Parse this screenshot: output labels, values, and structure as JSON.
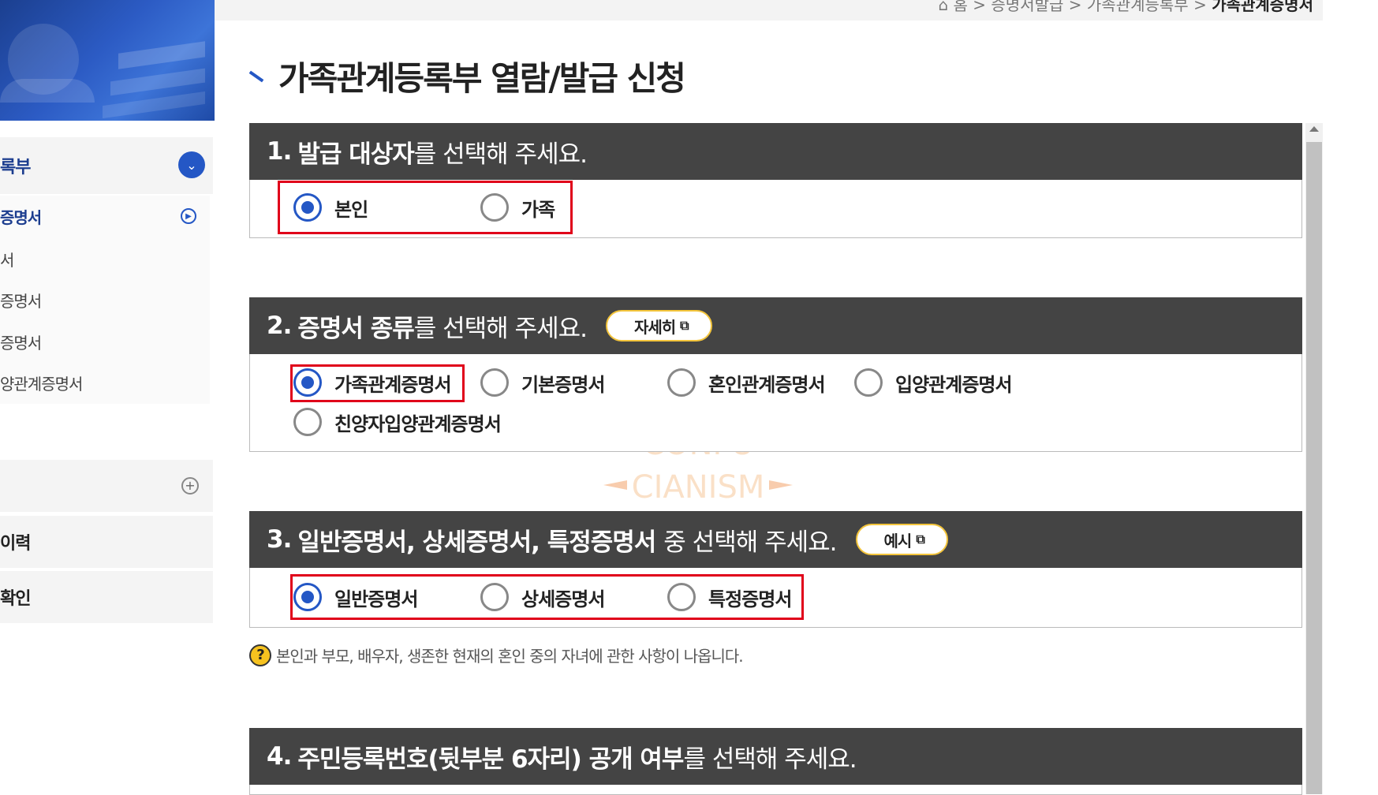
{
  "sidebar": {
    "menu_head_label": "록부",
    "sub_items": [
      "증명서",
      "서",
      "증명서",
      "증명서",
      "양관계증명서"
    ],
    "row1_label": "",
    "row2_label": "이력",
    "row3_label": "확인"
  },
  "breadcrumb": {
    "home": "홈",
    "sep": ">",
    "level1": "증명서발급",
    "level2": "가족관계등록부",
    "current": "가족관계증명서"
  },
  "page": {
    "title": "가족관계등록부 열람/발급 신청"
  },
  "sections": [
    {
      "num": "1.",
      "bold": "발급 대상자",
      "rest": "를 선택해 주세요.",
      "options": [
        {
          "label": "본인",
          "checked": true
        },
        {
          "label": "가족",
          "checked": false
        }
      ]
    },
    {
      "num": "2.",
      "bold": "증명서 종류",
      "rest": "를 선택해 주세요.",
      "button": "자세히",
      "options": [
        {
          "label": "가족관계증명서",
          "checked": true
        },
        {
          "label": "기본증명서",
          "checked": false
        },
        {
          "label": "혼인관계증명서",
          "checked": false
        },
        {
          "label": "입양관계증명서",
          "checked": false
        },
        {
          "label": "친양자입양관계증명서",
          "checked": false
        }
      ]
    },
    {
      "num": "3.",
      "bold": "일반증명서, 상세증명서, 특정증명서",
      "rest": "중 선택해 주세요.",
      "button": "예시",
      "options": [
        {
          "label": "일반증명서",
          "checked": true
        },
        {
          "label": "상세증명서",
          "checked": false
        },
        {
          "label": "특정증명서",
          "checked": false
        }
      ]
    },
    {
      "num": "4.",
      "bold": "주민등록번호(뒷부분 6자리) 공개 여부",
      "rest": "를 선택해 주세요."
    }
  ],
  "note": {
    "icon": "question-icon",
    "text": "본인과 부모, 배우자, 생존한 현재의 혼인 중의 자녀에 관한 사항이 나옵니다."
  },
  "watermark": [
    "CONFU",
    "CIANISM"
  ],
  "colors": {
    "accent": "#2457c5",
    "section_bar": "#444444",
    "highlight": "#e0001a",
    "pill_border": "#f3c43b"
  }
}
